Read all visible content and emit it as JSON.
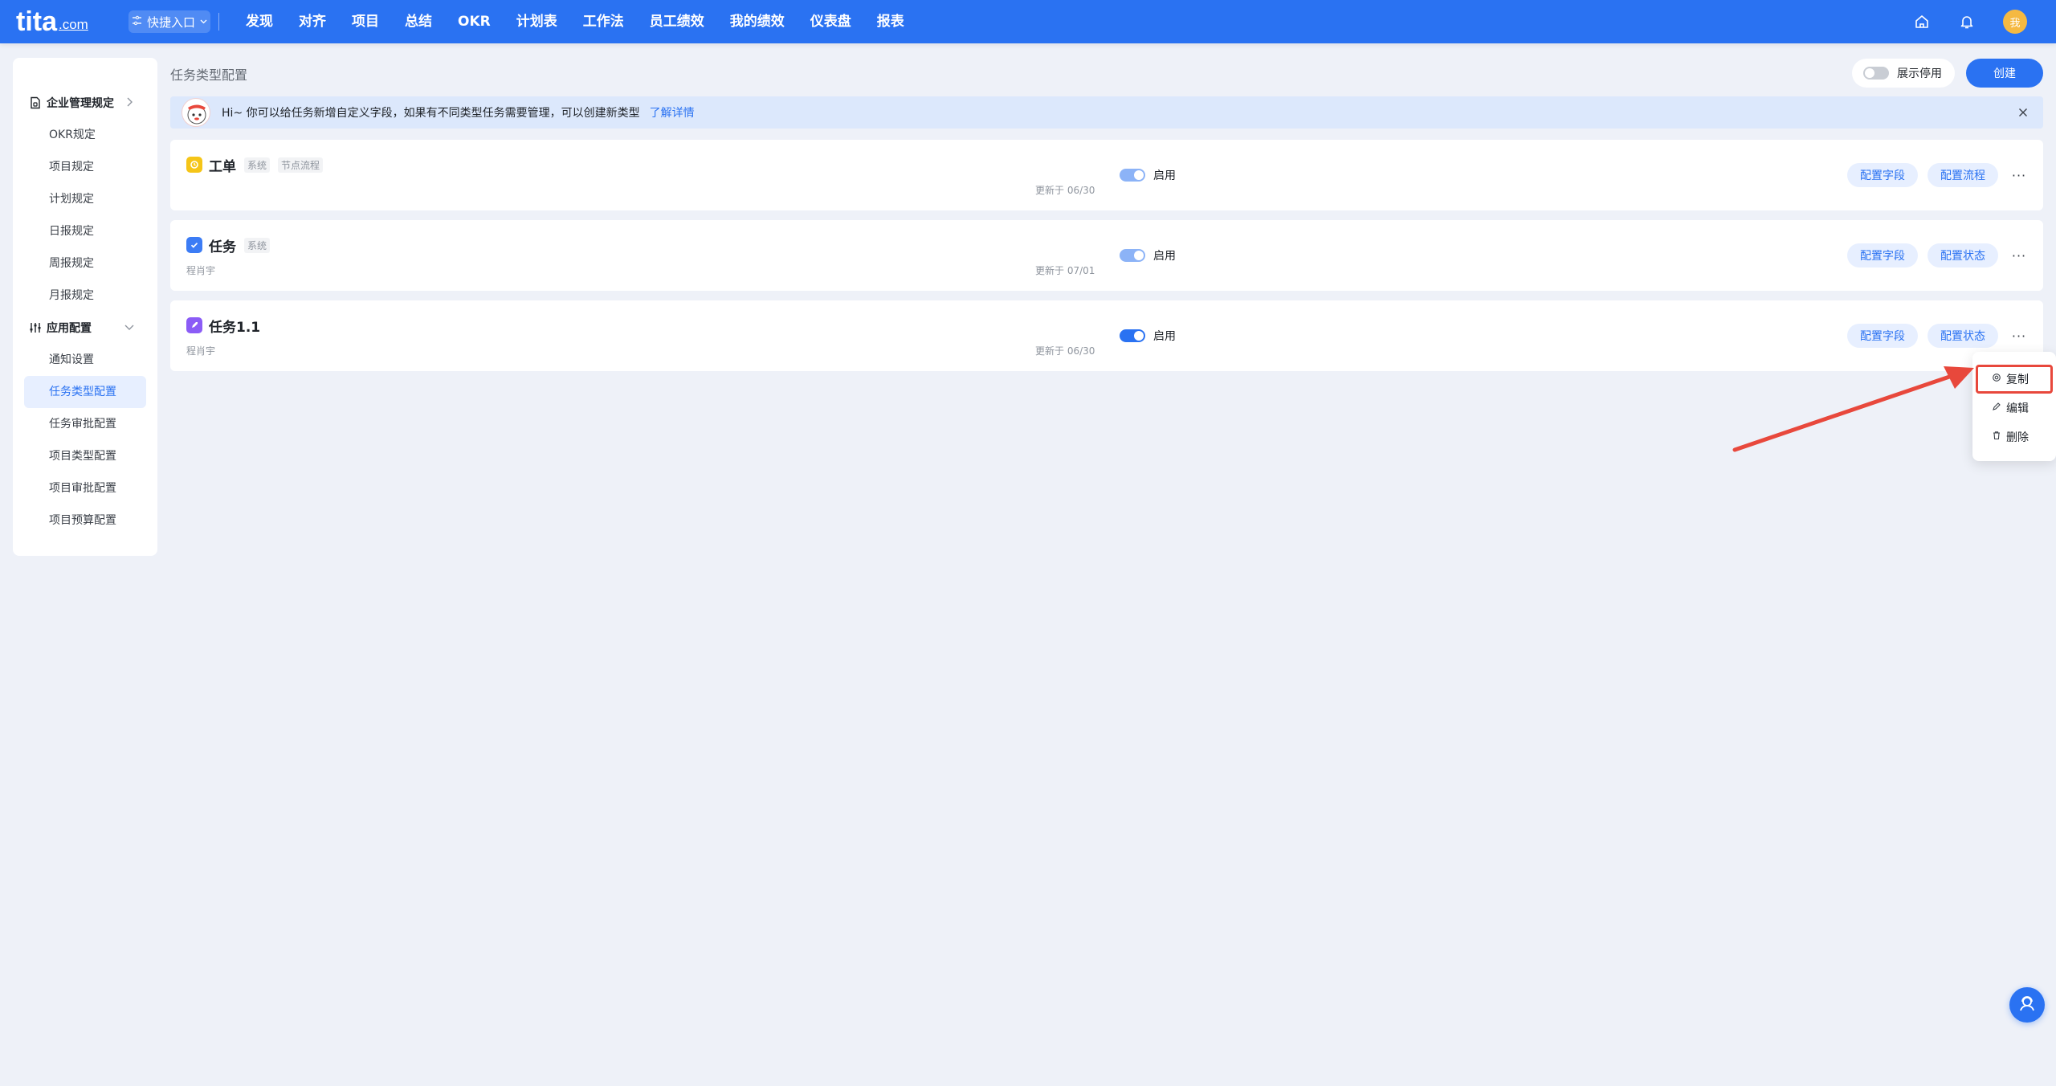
{
  "app": {
    "logo_text": "tita",
    "logo_suffix": ".com"
  },
  "topnav": {
    "quick_entry": "快捷入口",
    "items": [
      "发现",
      "对齐",
      "项目",
      "总结",
      "OKR",
      "计划表",
      "工作法",
      "员工绩效",
      "我的绩效",
      "仪表盘",
      "报表"
    ],
    "avatar_text": "我"
  },
  "sidebar": {
    "groups": [
      {
        "label": "企业管理规定",
        "items": [
          "OKR规定",
          "项目规定",
          "计划规定",
          "日报规定",
          "周报规定",
          "月报规定"
        ]
      },
      {
        "label": "应用配置",
        "items": [
          "通知设置",
          "任务类型配置",
          "任务审批配置",
          "项目类型配置",
          "项目审批配置",
          "项目预算配置"
        ]
      }
    ],
    "active_item": "任务类型配置"
  },
  "main": {
    "page_title": "任务类型配置",
    "show_disabled_label": "展示停用",
    "create_label": "创建",
    "banner": {
      "text": "Hi~ 你可以给任务新增自定义字段，如果有不同类型任务需要管理，可以创建新类型",
      "link": "了解详情"
    },
    "cards": [
      {
        "name": "工单",
        "tags": [
          "系统",
          "节点流程"
        ],
        "owner": "",
        "updated": "更新于 06/30",
        "status": "启用",
        "buttons": [
          "配置字段",
          "配置流程"
        ],
        "icon_color": "#f5c518"
      },
      {
        "name": "任务",
        "tags": [
          "系统"
        ],
        "owner": "程肖宇",
        "updated": "更新于 07/01",
        "status": "启用",
        "buttons": [
          "配置字段",
          "配置状态"
        ],
        "icon_color": "#3c7cf5"
      },
      {
        "name": "任务1.1",
        "tags": [],
        "owner": "程肖宇",
        "updated": "更新于 06/30",
        "status": "启用",
        "buttons": [
          "配置字段",
          "配置状态"
        ],
        "icon_color": "#8b5cf6"
      }
    ],
    "more_glyph": "···"
  },
  "dropdown": {
    "items": [
      "复制",
      "编辑",
      "删除"
    ]
  }
}
